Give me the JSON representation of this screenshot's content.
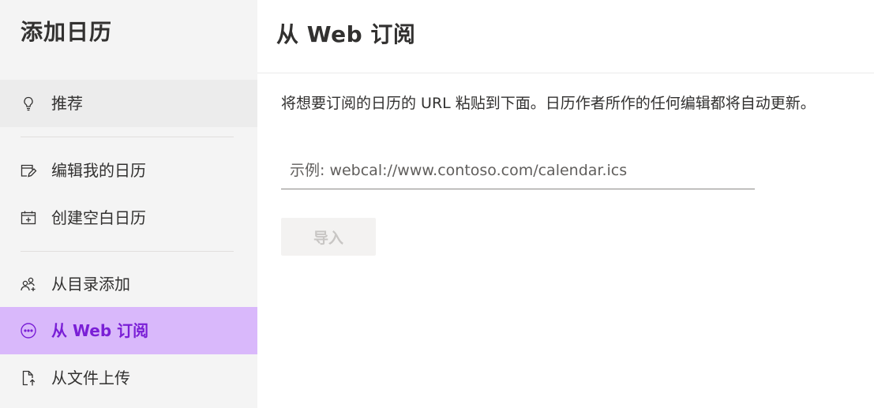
{
  "sidebar": {
    "title": "添加日历",
    "items": [
      {
        "label": "推荐",
        "icon": "lightbulb-icon"
      },
      {
        "label": "编辑我的日历",
        "icon": "edit-calendar-icon"
      },
      {
        "label": "创建空白日历",
        "icon": "add-calendar-icon"
      },
      {
        "label": "从目录添加",
        "icon": "people-add-icon"
      },
      {
        "label": "从 Web 订阅",
        "icon": "globe-icon",
        "active": true
      },
      {
        "label": "从文件上传",
        "icon": "file-upload-icon"
      }
    ]
  },
  "main": {
    "title": "从 Web 订阅",
    "description": "将想要订阅的日历的 URL 粘贴到下面。日历作者所作的任何编辑都将自动更新。",
    "url_input": {
      "value": "",
      "placeholder": "示例: webcal://www.contoso.com/calendar.ics"
    },
    "import_button": {
      "label": "导入",
      "enabled": false
    }
  },
  "colors": {
    "accent": "#7a1fd6",
    "active_bg": "#d9b8fb",
    "sidebar_bg": "#f4f4f4"
  }
}
